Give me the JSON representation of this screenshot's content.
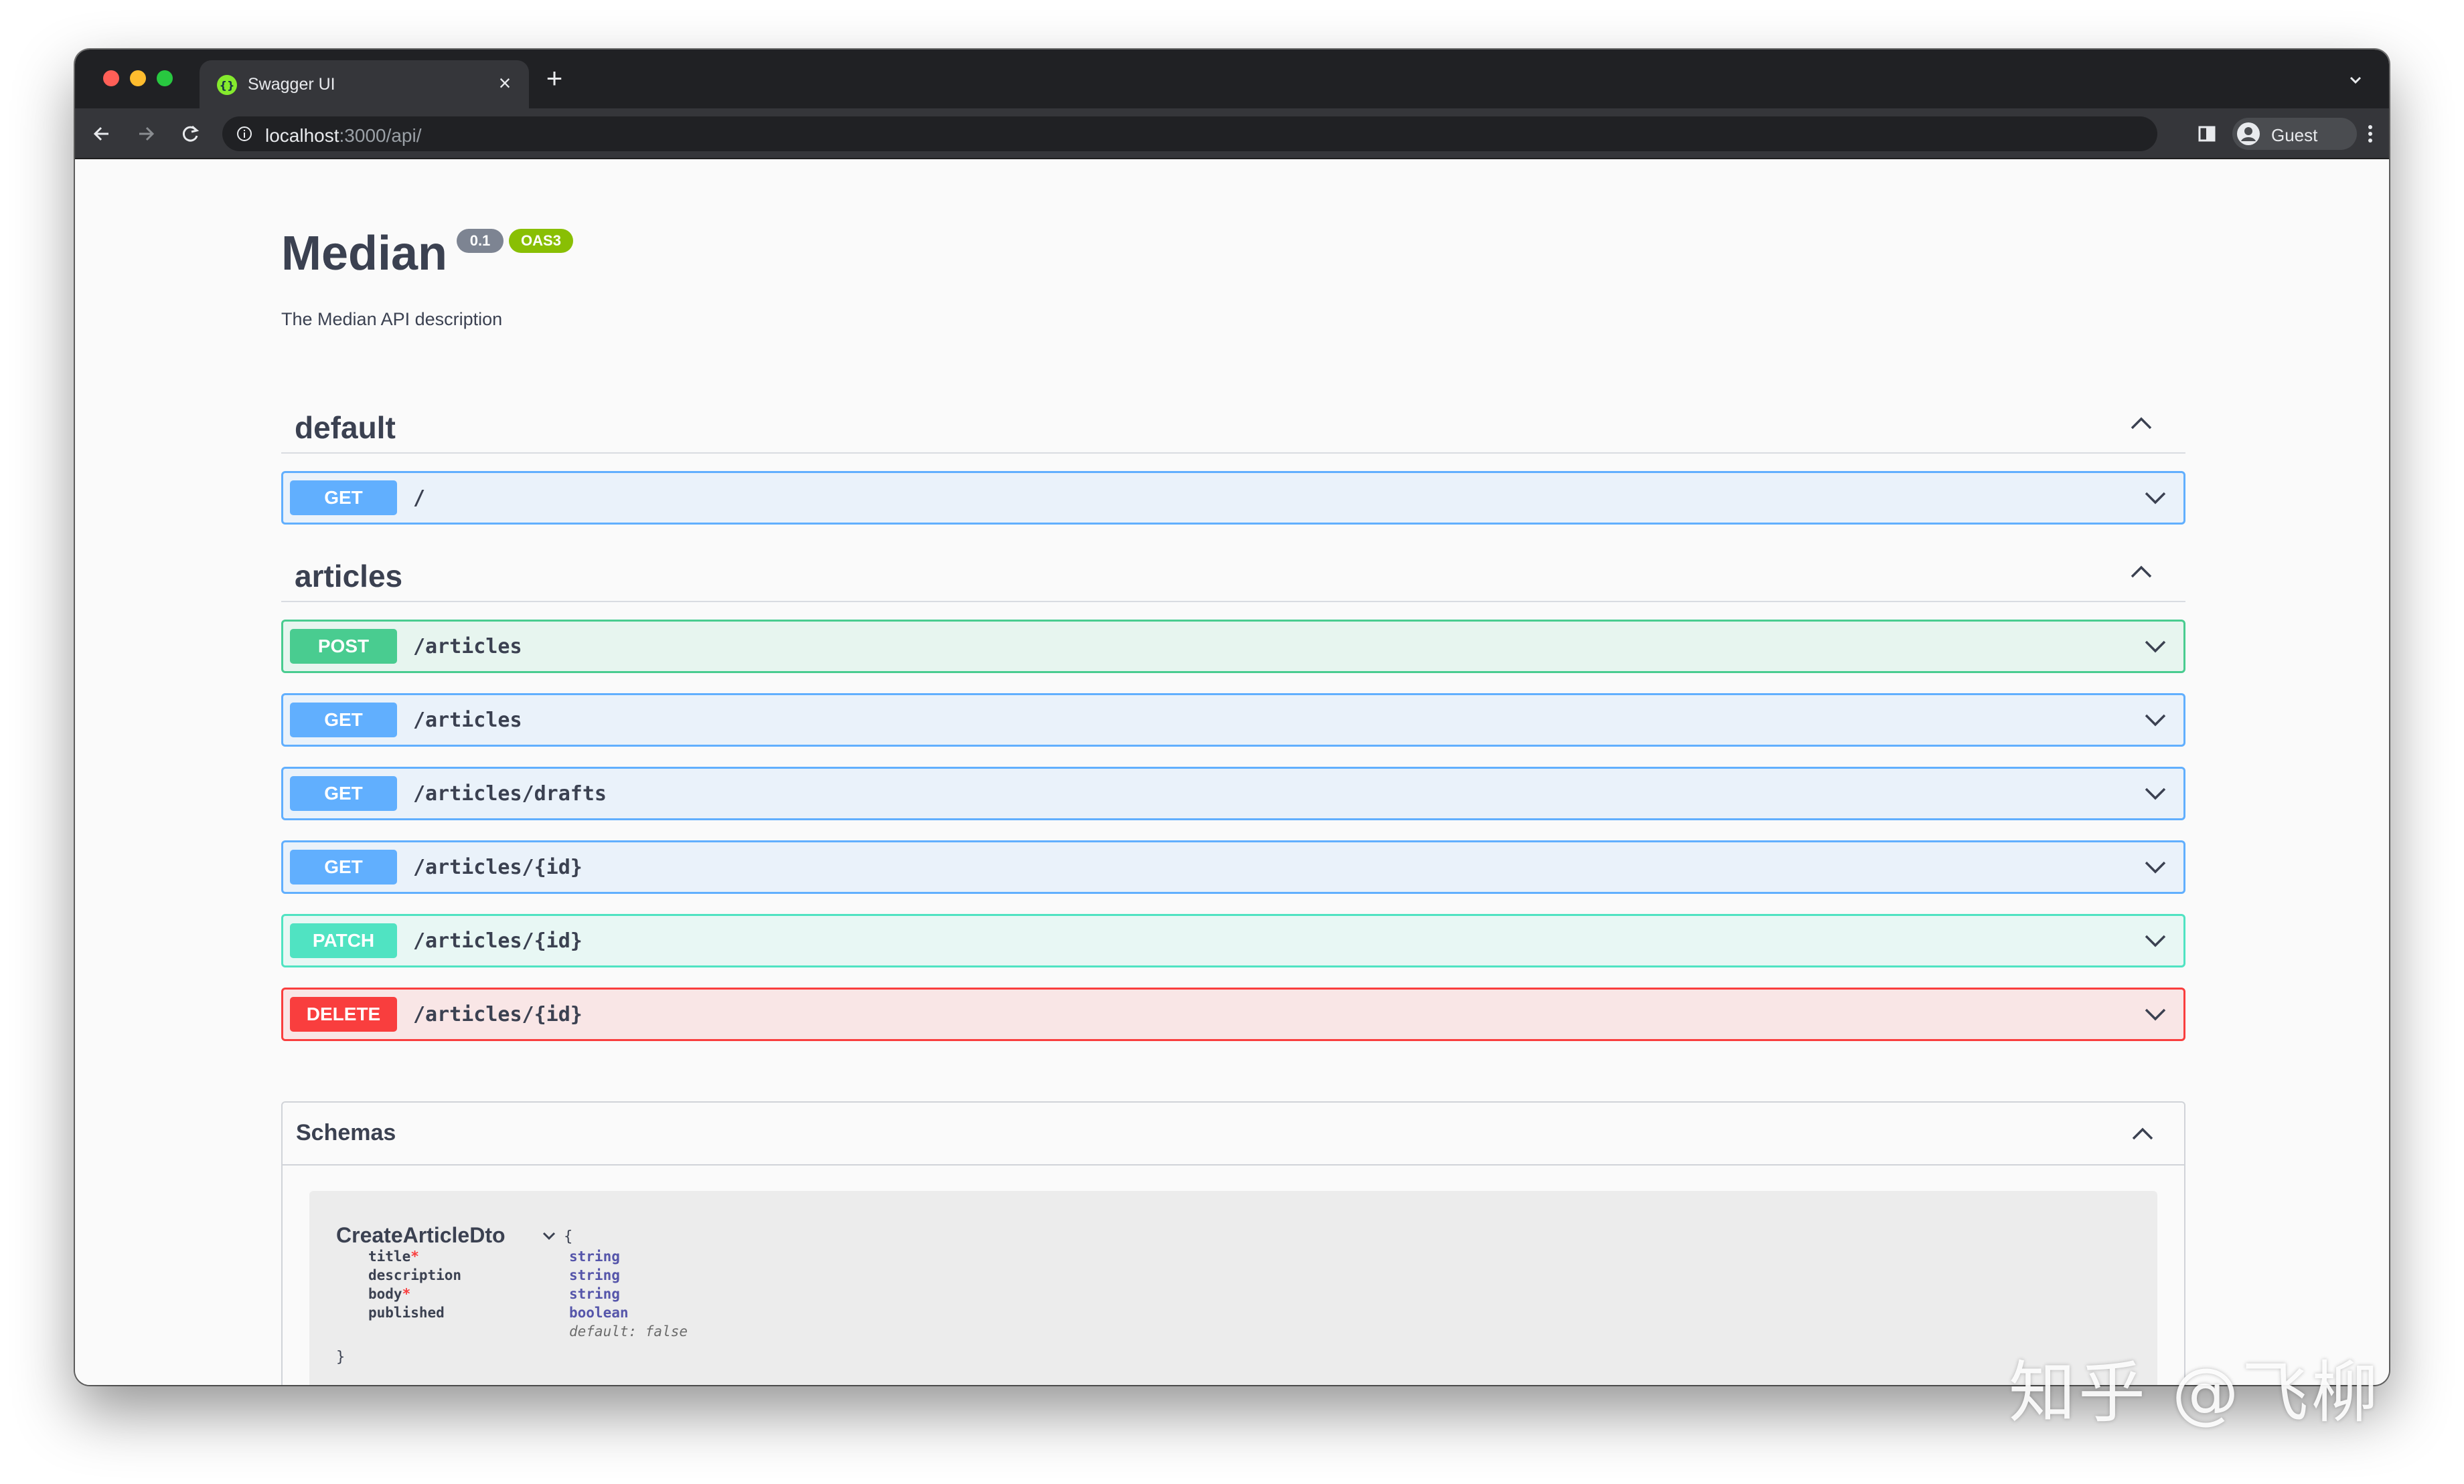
{
  "browser": {
    "tab_title": "Swagger UI",
    "tab_close": "×",
    "new_tab": "+",
    "url_host": "localhost",
    "url_path": ":3000/api/",
    "profile_name": "Guest"
  },
  "api": {
    "title": "Median",
    "version": "0.1",
    "oas": "OAS3",
    "description": "The Median API description"
  },
  "sections": [
    {
      "title": "default",
      "operations": [
        {
          "method": "GET",
          "path": "/"
        }
      ]
    },
    {
      "title": "articles",
      "operations": [
        {
          "method": "POST",
          "path": "/articles"
        },
        {
          "method": "GET",
          "path": "/articles"
        },
        {
          "method": "GET",
          "path": "/articles/drafts"
        },
        {
          "method": "GET",
          "path": "/articles/{id}"
        },
        {
          "method": "PATCH",
          "path": "/articles/{id}"
        },
        {
          "method": "DELETE",
          "path": "/articles/{id}"
        }
      ]
    }
  ],
  "schemas": {
    "title": "Schemas",
    "model": {
      "name": "CreateArticleDto",
      "open_brace": "{",
      "close_brace": "}",
      "properties": [
        {
          "name": "title",
          "required": "*",
          "type": "string"
        },
        {
          "name": "description",
          "required": "",
          "type": "string"
        },
        {
          "name": "body",
          "required": "*",
          "type": "string"
        },
        {
          "name": "published",
          "required": "",
          "type": "boolean",
          "default": "default: false"
        }
      ]
    }
  },
  "watermark": "知乎 @飞柳",
  "colors": {
    "get": "#61affe",
    "post": "#49cc90",
    "patch": "#50e3c2",
    "delete": "#f93e3e",
    "oas_badge": "#89bf04",
    "version_badge": "#7d8492"
  },
  "icons": {
    "favicon": "swagger-icon",
    "section_toggle": "chevron-up-icon",
    "op_toggle": "chevron-down-icon"
  }
}
